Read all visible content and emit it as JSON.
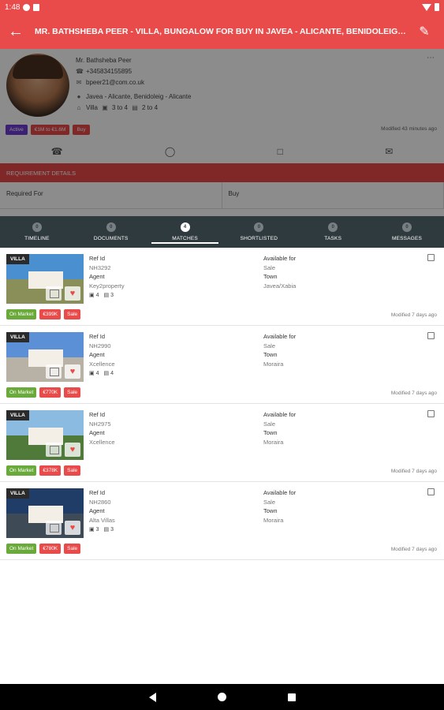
{
  "status_bar": {
    "time": "1:48"
  },
  "app_bar": {
    "title": "MR. BATHSHEBA PEER - VILLA, BUNGALOW FOR BUY IN JAVEA - ALICANTE, BENIDOLEIG - ALICANTE, B..."
  },
  "contact": {
    "name": "Mr. Bathsheba Peer",
    "phone": "+345834155895",
    "email": "bpeer21@com.co.uk",
    "location": "Javea - Alicante, Benidoleig - Alicante",
    "property_type": "Villa",
    "beds": "3 to 4",
    "baths": "2 to 4",
    "tags": [
      "Active",
      "€1M to €1.6M",
      "Buy"
    ],
    "modified": "Modified 43 minutes ago"
  },
  "requirement": {
    "header": "REQUIREMENT DETAILS",
    "required_for": "Required For",
    "required_for_value": "Buy"
  },
  "tabs": [
    {
      "label": "TIMELINE",
      "count": "0"
    },
    {
      "label": "DOCUMENTS",
      "count": "0"
    },
    {
      "label": "MATCHES",
      "count": "4",
      "active": true
    },
    {
      "label": "SHORTLISTED",
      "count": "0"
    },
    {
      "label": "TASKS",
      "count": "0"
    },
    {
      "label": "MESSAGES",
      "count": "0"
    }
  ],
  "listings": [
    {
      "type_label": "VILLA",
      "ref_label": "Ref Id",
      "ref": "NH3292",
      "agent_label": "Agent",
      "agent": "Key2property",
      "beds": "4",
      "baths": "3",
      "available_label": "Available for",
      "available": "Sale",
      "town_label": "Town",
      "town": "Javea/Xabia",
      "badges": [
        "On Market",
        "€399K",
        "Sale"
      ],
      "modified": "Modified 7 days ago",
      "sky": "#4a90d0",
      "ground": "#8a8f5a"
    },
    {
      "type_label": "VILLA",
      "ref_label": "Ref Id",
      "ref": "NH2990",
      "agent_label": "Agent",
      "agent": "Xcellence",
      "beds": "4",
      "baths": "4",
      "available_label": "Available for",
      "available": "Sale",
      "town_label": "Town",
      "town": "Moraira",
      "badges": [
        "On Market",
        "€770K",
        "Sale"
      ],
      "modified": "Modified 7 days ago",
      "sky": "#5b8fd6",
      "ground": "#b7b2a5"
    },
    {
      "type_label": "VILLA",
      "ref_label": "Ref Id",
      "ref": "NH2975",
      "agent_label": "Agent",
      "agent": "Xcellence",
      "beds": "",
      "baths": "",
      "available_label": "Available for",
      "available": "Sale",
      "town_label": "Town",
      "town": "Moraira",
      "badges": [
        "On Market",
        "€378K",
        "Sale"
      ],
      "modified": "Modified 7 days ago",
      "sky": "#8bbbe0",
      "ground": "#4f7a3a"
    },
    {
      "type_label": "VILLA",
      "ref_label": "Ref Id",
      "ref": "NH2860",
      "agent_label": "Agent",
      "agent": "Alta Villas",
      "beds": "3",
      "baths": "3",
      "available_label": "Available for",
      "available": "Sale",
      "town_label": "Town",
      "town": "Moraira",
      "badges": [
        "On Market",
        "€780K",
        "Sale"
      ],
      "modified": "Modified 7 days ago",
      "sky": "#1f3d66",
      "ground": "#3e4a55"
    }
  ]
}
